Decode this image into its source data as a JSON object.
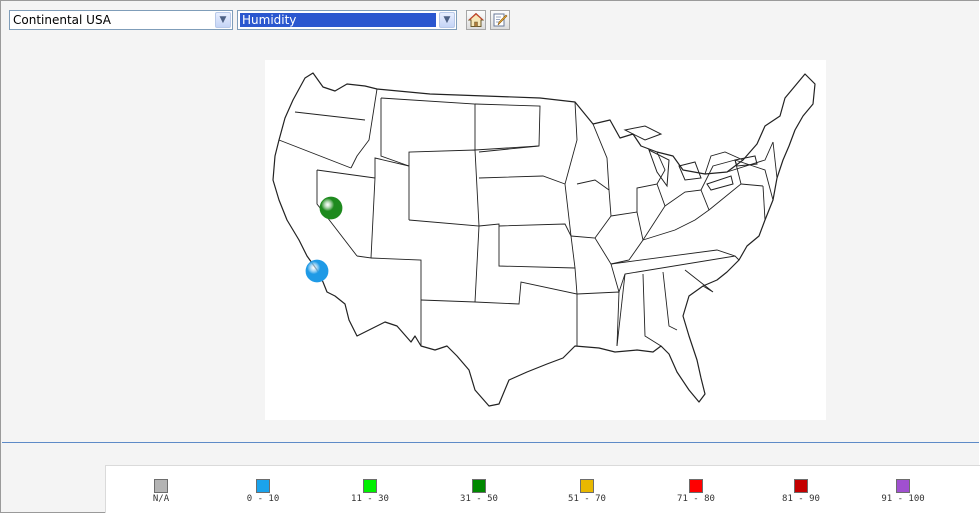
{
  "toolbar": {
    "region_value": "Continental USA",
    "layer_value": "Humidity",
    "home_icon": "home-icon",
    "edit_icon": "edit-page-icon"
  },
  "map": {
    "markers": [
      {
        "color": "#1e8a1e",
        "legend_range": "31 - 50"
      },
      {
        "color": "#1f9ae6",
        "legend_range": "0 - 10"
      }
    ]
  },
  "legend": [
    {
      "label": "N/A",
      "color": "#b4b4b4"
    },
    {
      "label": "0 - 10",
      "color": "#1aa3ec"
    },
    {
      "label": "11 - 30",
      "color": "#00f000"
    },
    {
      "label": "31 - 50",
      "color": "#008800"
    },
    {
      "label": "51 - 70",
      "color": "#e8b800"
    },
    {
      "label": "71 - 80",
      "color": "#ff0000"
    },
    {
      "label": "81 - 90",
      "color": "#c40000"
    },
    {
      "label": "91 - 100",
      "color": "#a050d0"
    }
  ]
}
